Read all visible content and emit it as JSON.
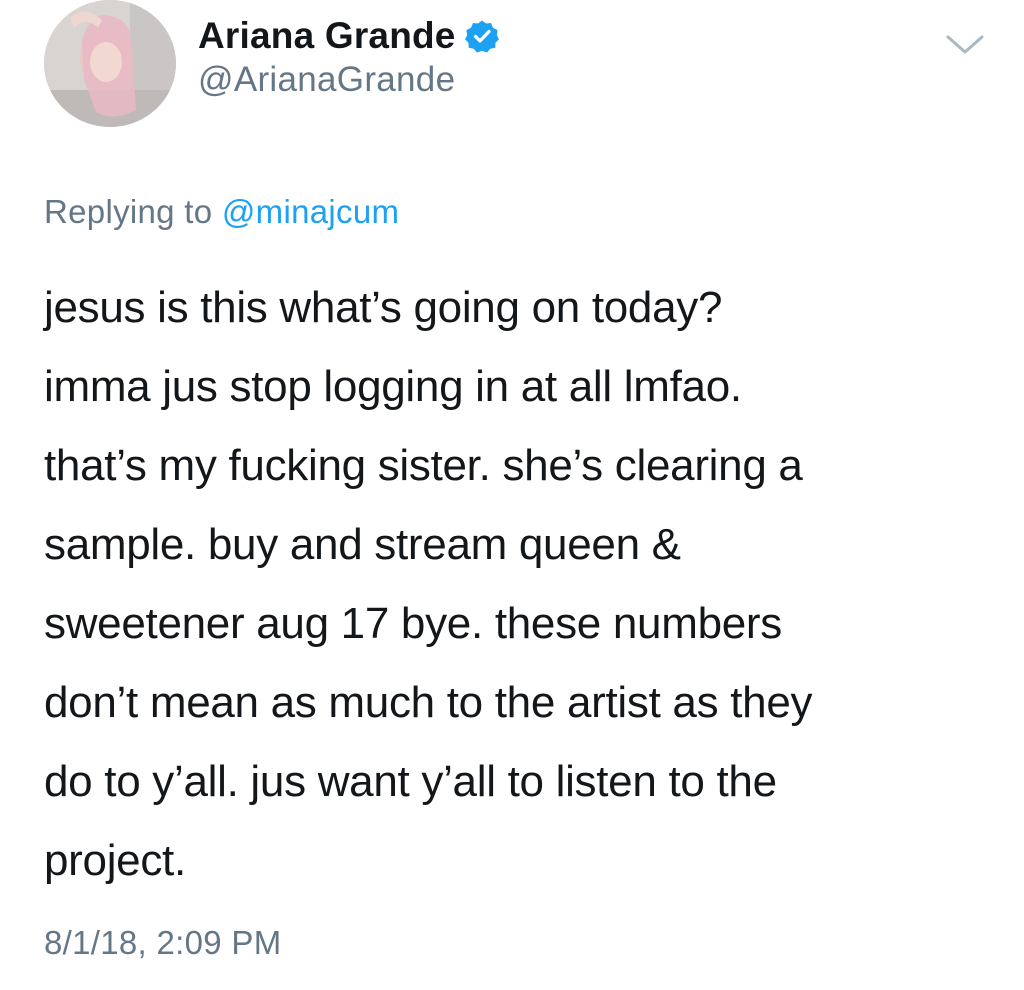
{
  "author": {
    "display_name": "Ariana Grande",
    "handle": "@ArianaGrande",
    "verified": true,
    "avatar_icon": "profile-photo"
  },
  "reply": {
    "prefix": "Replying to",
    "mention": "@minajcum"
  },
  "tweet": {
    "lines": [
      "jesus is this what’s going on today?",
      "imma jus stop logging in at all lmfao.",
      "that’s my fucking sister. she’s clearing a",
      "sample. buy and stream queen &",
      "sweetener aug 17 bye. these numbers",
      "don’t mean as much to the artist as they",
      "do to y’all. jus want y’all to listen to the",
      "project."
    ]
  },
  "timestamp": "8/1/18, 2:09 PM",
  "colors": {
    "text": "#14171a",
    "secondary": "#657786",
    "accent": "#1da1f2",
    "chevron": "#aab8c2"
  }
}
